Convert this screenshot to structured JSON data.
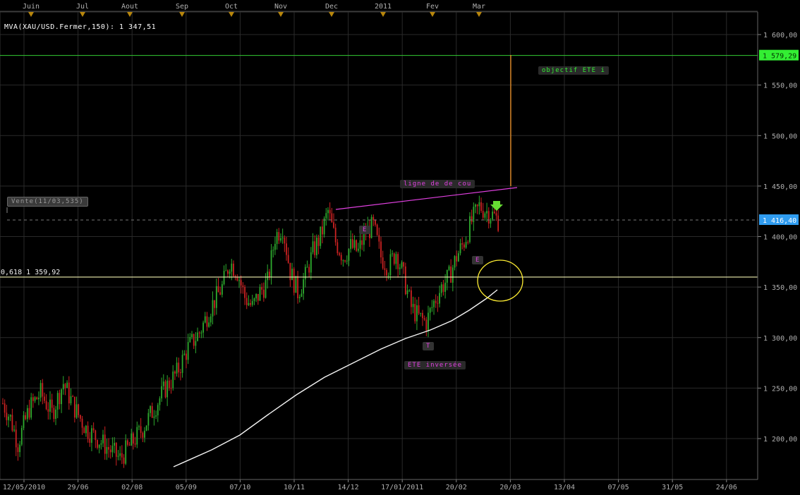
{
  "indicator_label": "MVA(XAU/USD.Fermer,150): 1 347,51",
  "chart_data": {
    "type": "candlestick",
    "title": "",
    "xlabel": "",
    "ylabel": "",
    "ylim": [
      1165,
      1625
    ],
    "grid": true,
    "month_labels": [
      "Juin",
      "Jul",
      "Aout",
      "Sep",
      "Oct",
      "Nov",
      "Dec",
      "2011",
      "Fev",
      "Mar"
    ],
    "x_tick_labels": [
      "12/05/2010",
      "29/06",
      "02/08",
      "05/09",
      "07/10",
      "10/11",
      "14/12",
      "17/01/2011",
      "20/02",
      "20/03",
      "13/04",
      "07/05",
      "31/05",
      "24/06"
    ],
    "y_tick_labels": [
      "1 600,00",
      "1 550,00",
      "1 500,00",
      "1 450,00",
      "1 400,00",
      "1 350,00",
      "1 300,00",
      "1 250,00",
      "1 200,00"
    ],
    "y_ticks": [
      1600,
      1550,
      1500,
      1450,
      1400,
      1350,
      1300,
      1250,
      1200
    ],
    "price_tags": {
      "target": {
        "value": 1579.29,
        "text": "1 579,29",
        "color": "#33ee33"
      },
      "last": {
        "value": 1416.4,
        "text": "1 416,40",
        "color": "#2f9cf0"
      }
    },
    "fib_level": {
      "value": 1359.92,
      "text": "0,618 1 359,92"
    },
    "sell_marker": {
      "text": "Vente(11/03,535)"
    },
    "annotations": {
      "target_label": "objectif ETE i",
      "neckline_label": "ligne de de cou",
      "shoulder_left": "E",
      "head": "T",
      "shoulder_right": "E",
      "pattern_label": "ETE inversée"
    },
    "ma_series": {
      "name": "MVA(XAU/USD.Fermer,150)",
      "last_value": 1347.51
    },
    "price_path": [
      [
        0,
        1235
      ],
      [
        4,
        1220
      ],
      [
        8,
        1195
      ],
      [
        14,
        1230
      ],
      [
        20,
        1245
      ],
      [
        26,
        1225
      ],
      [
        32,
        1255
      ],
      [
        38,
        1230
      ],
      [
        44,
        1210
      ],
      [
        50,
        1200
      ],
      [
        56,
        1190
      ],
      [
        62,
        1180
      ],
      [
        68,
        1195
      ],
      [
        74,
        1210
      ],
      [
        80,
        1230
      ],
      [
        86,
        1250
      ],
      [
        92,
        1265
      ],
      [
        98,
        1290
      ],
      [
        104,
        1305
      ],
      [
        110,
        1330
      ],
      [
        116,
        1350
      ],
      [
        120,
        1375
      ],
      [
        124,
        1365
      ],
      [
        128,
        1340
      ],
      [
        132,
        1330
      ],
      [
        136,
        1345
      ],
      [
        140,
        1355
      ],
      [
        144,
        1400
      ],
      [
        148,
        1410
      ],
      [
        152,
        1365
      ],
      [
        156,
        1345
      ],
      [
        160,
        1360
      ],
      [
        164,
        1385
      ],
      [
        168,
        1400
      ],
      [
        172,
        1425
      ],
      [
        176,
        1395
      ],
      [
        180,
        1380
      ],
      [
        184,
        1390
      ],
      [
        188,
        1385
      ],
      [
        192,
        1405
      ],
      [
        196,
        1410
      ],
      [
        200,
        1380
      ],
      [
        204,
        1370
      ],
      [
        208,
        1385
      ],
      [
        212,
        1360
      ],
      [
        216,
        1330
      ],
      [
        220,
        1320
      ],
      [
        224,
        1315
      ],
      [
        228,
        1335
      ],
      [
        232,
        1350
      ],
      [
        236,
        1360
      ],
      [
        240,
        1380
      ],
      [
        244,
        1395
      ],
      [
        248,
        1415
      ],
      [
        252,
        1430
      ],
      [
        256,
        1425
      ],
      [
        260,
        1420
      ],
      [
        262,
        1416
      ]
    ]
  }
}
